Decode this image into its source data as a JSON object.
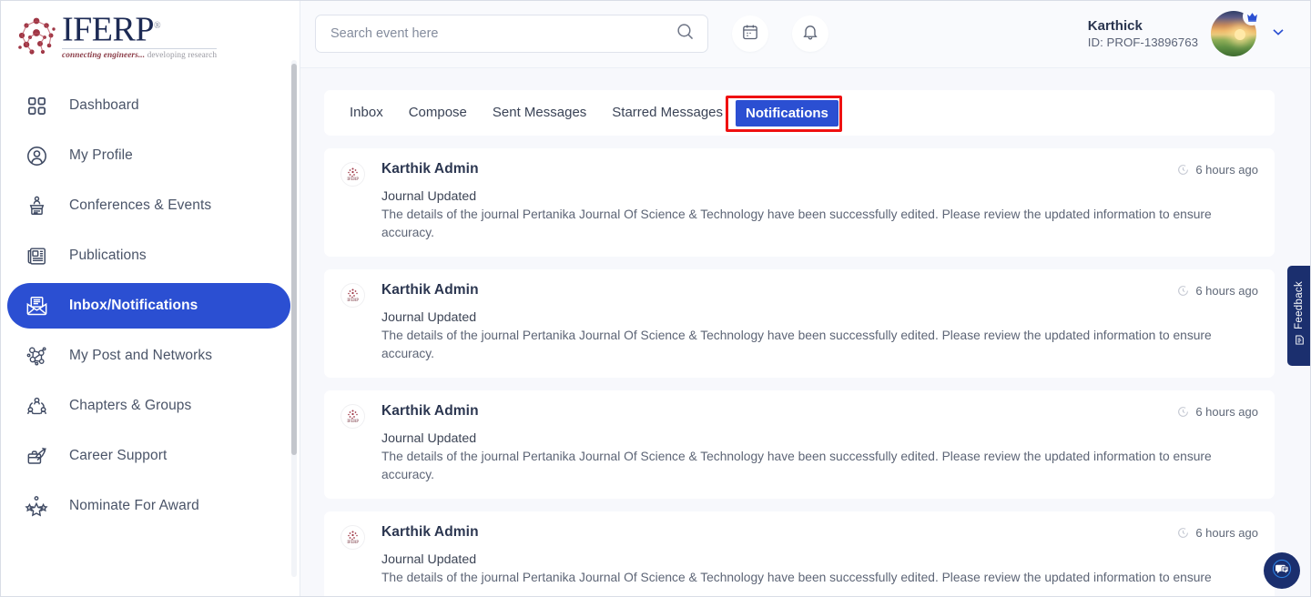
{
  "brand": {
    "name": "IFERP",
    "registered": "®",
    "tagline_a": "connecting engineers...",
    "tagline_b": "developing research",
    "logo_icon": "iferp-logo-icon"
  },
  "sidebar": {
    "items": [
      {
        "label": "Dashboard",
        "icon": "grid-icon",
        "active": false
      },
      {
        "label": "My Profile",
        "icon": "user-circle-icon",
        "active": false
      },
      {
        "label": "Conferences & Events",
        "icon": "podium-icon",
        "active": false
      },
      {
        "label": "Publications",
        "icon": "newspaper-icon",
        "active": false
      },
      {
        "label": "Inbox/Notifications",
        "icon": "envelope-icon",
        "active": true
      },
      {
        "label": "My Post and Networks",
        "icon": "network-icon",
        "active": false
      },
      {
        "label": "Chapters & Groups",
        "icon": "people-group-icon",
        "active": false
      },
      {
        "label": "Career Support",
        "icon": "briefcase-icon",
        "active": false
      },
      {
        "label": "Nominate For Award",
        "icon": "award-stars-icon",
        "active": false
      }
    ]
  },
  "topbar": {
    "search": {
      "placeholder": "Search event here",
      "value": "",
      "icon": "search-icon"
    },
    "calendar_icon": "calendar-icon",
    "bell_icon": "bell-icon",
    "user": {
      "name": "Karthick",
      "id": "ID: PROF-13896763",
      "avatar_icon": "avatar-sunset-image",
      "badge_icon": "crown-badge-icon",
      "chevron_icon": "chevron-down-icon"
    }
  },
  "tabs": [
    {
      "label": "Inbox",
      "selected": false
    },
    {
      "label": "Compose",
      "selected": false
    },
    {
      "label": "Sent Messages",
      "selected": false
    },
    {
      "label": "Starred Messages",
      "selected": false
    },
    {
      "label": "Notifications",
      "selected": true
    }
  ],
  "notifications": [
    {
      "sender": "Karthik Admin",
      "title": "Journal Updated",
      "message": "The details of the journal Pertanika Journal Of Science & Technology have been successfully edited. Please review the updated information to ensure accuracy.",
      "time": "6 hours ago",
      "avatar_icon": "iferp-logo-icon",
      "clock_icon": "clock-icon"
    },
    {
      "sender": "Karthik Admin",
      "title": "Journal Updated",
      "message": "The details of the journal Pertanika Journal Of Science & Technology have been successfully edited. Please review the updated information to ensure accuracy.",
      "time": "6 hours ago",
      "avatar_icon": "iferp-logo-icon",
      "clock_icon": "clock-icon"
    },
    {
      "sender": "Karthik Admin",
      "title": "Journal Updated",
      "message": "The details of the journal Pertanika Journal Of Science & Technology have been successfully edited. Please review the updated information to ensure accuracy.",
      "time": "6 hours ago",
      "avatar_icon": "iferp-logo-icon",
      "clock_icon": "clock-icon"
    },
    {
      "sender": "Karthik Admin",
      "title": "Journal Updated",
      "message": "The details of the journal Pertanika Journal Of Science & Technology have been successfully edited. Please review the updated information to ensure",
      "time": "6 hours ago",
      "avatar_icon": "iferp-logo-icon",
      "clock_icon": "clock-icon"
    }
  ],
  "widgets": {
    "feedback": {
      "label": "Feedback",
      "icon": "feedback-form-icon"
    },
    "chat": {
      "icon": "chat-bubble-icon"
    }
  },
  "colors": {
    "accent_blue": "#2b4fd2",
    "navy": "#1b2f6e",
    "highlight_red": "#ef1111",
    "page_bg": "#f7f8fc",
    "card_bg": "#ffffff"
  }
}
